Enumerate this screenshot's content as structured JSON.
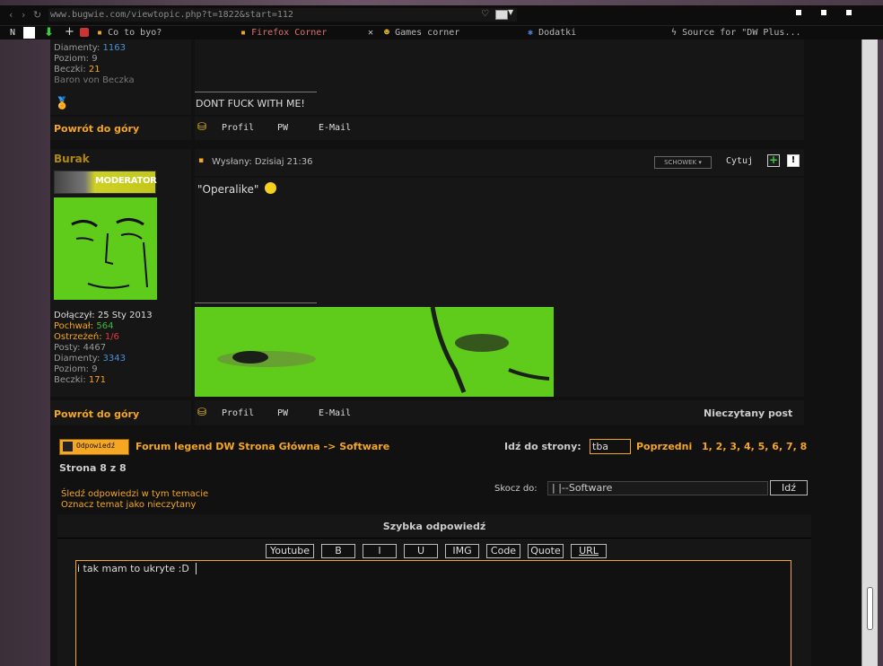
{
  "browser": {
    "url": "www.bugwie.com/viewtopic.php?t=1822&start=112",
    "tabs": [
      {
        "label": "Co to byo?"
      },
      {
        "label": "Firefox Corner"
      },
      {
        "label": "Games corner"
      },
      {
        "label": "Dodatki"
      },
      {
        "label": "Source for \"DW Plus..."
      }
    ],
    "toolbar_letter": "N",
    "plus_label": "+",
    "tab_close": "✕"
  },
  "prev_post": {
    "line1": "Diamenty:",
    "line1_val": "1163",
    "line2": "Poziom:",
    "line2_val": "9",
    "line3": "Beczki:",
    "line3_val": "21",
    "rank": "Baron von Beczka",
    "signature": "DONT FUCK WITH ME!",
    "back_to_top": "Powrót do góry",
    "links": [
      "Profil",
      "PW",
      "E-Mail"
    ]
  },
  "post": {
    "author": "Burak",
    "badge": "MODERATOR",
    "posted_label": "Wysłany: Dzisiaj 21:36",
    "schowek": "SCHOWEK",
    "quote": "Cytuj",
    "body": "\"Operalike\"",
    "joined_label": "Dołączył:",
    "joined_val": "25 Sty 2013",
    "praise_label": "Pochwał:",
    "praise_val": "564",
    "warn_label": "Ostrzeżeń:",
    "warn_val": "1/6",
    "posts_label": "Posty:",
    "posts_val": "4467",
    "diamonds_label": "Diamenty:",
    "diamonds_val": "3343",
    "level_label": "Poziom:",
    "level_val": "9",
    "barrels_label": "Beczki:",
    "barrels_val": "171",
    "back_to_top": "Powrót do góry",
    "links": [
      "Profil",
      "PW",
      "E-Mail"
    ],
    "unread": "Nieczytany post"
  },
  "nav": {
    "reply_button": "Odpowiedź",
    "forum_home": "Forum legend DW Strona Główna",
    "arrow": "->",
    "section": "Software",
    "goto_label": "Idź do strony:",
    "goto_value": "tba",
    "prev": "Poprzedni",
    "pages": "1, 2, 3, 4, 5, 6, 7, 8",
    "page_of": "Strona 8 z 8",
    "watch": "Śledź odpowiedzi w tym temacie",
    "mark_unread": "Oznacz temat jako nieczytany",
    "jump_label": "Skocz do:",
    "jump_value": "|   |--Software",
    "go_button": "Idź"
  },
  "quick_reply": {
    "title": "Szybka odpowiedź",
    "buttons": [
      "Youtube",
      "B",
      "I",
      "U",
      "IMG",
      "Code",
      "Quote",
      "URL"
    ],
    "text": "i tak mam to ukryte :D"
  },
  "colors": {
    "accent": "#f5a623",
    "avatar_green": "#5fcc1b"
  }
}
